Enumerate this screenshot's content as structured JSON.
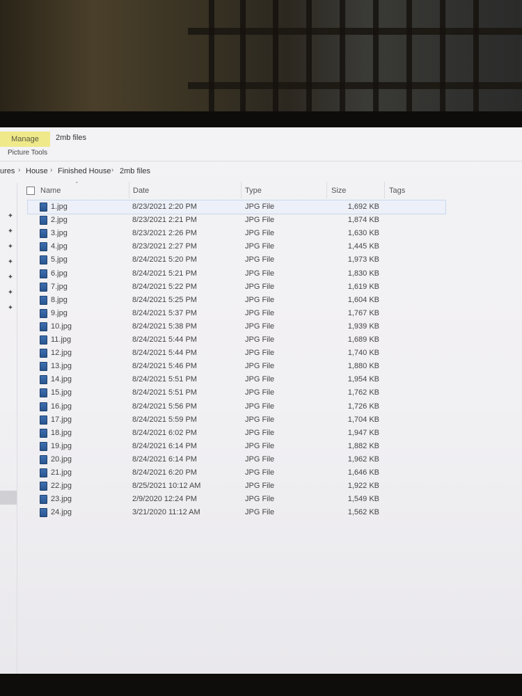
{
  "window": {
    "ribbon_tab": "Manage",
    "title": "2mb files",
    "context_label": "Picture Tools"
  },
  "breadcrumb": [
    "ures",
    "House",
    "Finished House",
    "2mb files"
  ],
  "columns": {
    "name": "Name",
    "date": "Date",
    "type": "Type",
    "size": "Size",
    "tags": "Tags"
  },
  "files": [
    {
      "name": "1.jpg",
      "date": "8/23/2021 2:20 PM",
      "type": "JPG File",
      "size": "1,692 KB"
    },
    {
      "name": "2.jpg",
      "date": "8/23/2021 2:21 PM",
      "type": "JPG File",
      "size": "1,874 KB"
    },
    {
      "name": "3.jpg",
      "date": "8/23/2021 2:26 PM",
      "type": "JPG File",
      "size": "1,630 KB"
    },
    {
      "name": "4.jpg",
      "date": "8/23/2021 2:27 PM",
      "type": "JPG File",
      "size": "1,445 KB"
    },
    {
      "name": "5.jpg",
      "date": "8/24/2021 5:20 PM",
      "type": "JPG File",
      "size": "1,973 KB"
    },
    {
      "name": "6.jpg",
      "date": "8/24/2021 5:21 PM",
      "type": "JPG File",
      "size": "1,830 KB"
    },
    {
      "name": "7.jpg",
      "date": "8/24/2021 5:22 PM",
      "type": "JPG File",
      "size": "1,619 KB"
    },
    {
      "name": "8.jpg",
      "date": "8/24/2021 5:25 PM",
      "type": "JPG File",
      "size": "1,604 KB"
    },
    {
      "name": "9.jpg",
      "date": "8/24/2021 5:37 PM",
      "type": "JPG File",
      "size": "1,767 KB"
    },
    {
      "name": "10.jpg",
      "date": "8/24/2021 5:38 PM",
      "type": "JPG File",
      "size": "1,939 KB"
    },
    {
      "name": "11.jpg",
      "date": "8/24/2021 5:44 PM",
      "type": "JPG File",
      "size": "1,689 KB"
    },
    {
      "name": "12.jpg",
      "date": "8/24/2021 5:44 PM",
      "type": "JPG File",
      "size": "1,740 KB"
    },
    {
      "name": "13.jpg",
      "date": "8/24/2021 5:46 PM",
      "type": "JPG File",
      "size": "1,880 KB"
    },
    {
      "name": "14.jpg",
      "date": "8/24/2021 5:51 PM",
      "type": "JPG File",
      "size": "1,954 KB"
    },
    {
      "name": "15.jpg",
      "date": "8/24/2021 5:51 PM",
      "type": "JPG File",
      "size": "1,762 KB"
    },
    {
      "name": "16.jpg",
      "date": "8/24/2021 5:56 PM",
      "type": "JPG File",
      "size": "1,726 KB"
    },
    {
      "name": "17.jpg",
      "date": "8/24/2021 5:59 PM",
      "type": "JPG File",
      "size": "1,704 KB"
    },
    {
      "name": "18.jpg",
      "date": "8/24/2021 6:02 PM",
      "type": "JPG File",
      "size": "1,947 KB"
    },
    {
      "name": "19.jpg",
      "date": "8/24/2021 6:14 PM",
      "type": "JPG File",
      "size": "1,882 KB"
    },
    {
      "name": "20.jpg",
      "date": "8/24/2021 6:14 PM",
      "type": "JPG File",
      "size": "1,962 KB"
    },
    {
      "name": "21.jpg",
      "date": "8/24/2021 6:20 PM",
      "type": "JPG File",
      "size": "1,646 KB"
    },
    {
      "name": "22.jpg",
      "date": "8/25/2021 10:12 AM",
      "type": "JPG File",
      "size": "1,922 KB"
    },
    {
      "name": "23.jpg",
      "date": "2/9/2020 12:24 PM",
      "type": "JPG File",
      "size": "1,549 KB"
    },
    {
      "name": "24.jpg",
      "date": "3/21/2020 11:12 AM",
      "type": "JPG File",
      "size": "1,562 KB"
    }
  ],
  "pinned_count": 7,
  "icons": {
    "pin": "pin-icon",
    "file": "jpg-file-icon",
    "separator": "chevron-right-icon",
    "sort": "sort-ascending-icon"
  },
  "colors": {
    "manage_tab": "#efe98a",
    "file_icon": "#3f6fb0",
    "screen_bg": "#f2f1f4"
  }
}
